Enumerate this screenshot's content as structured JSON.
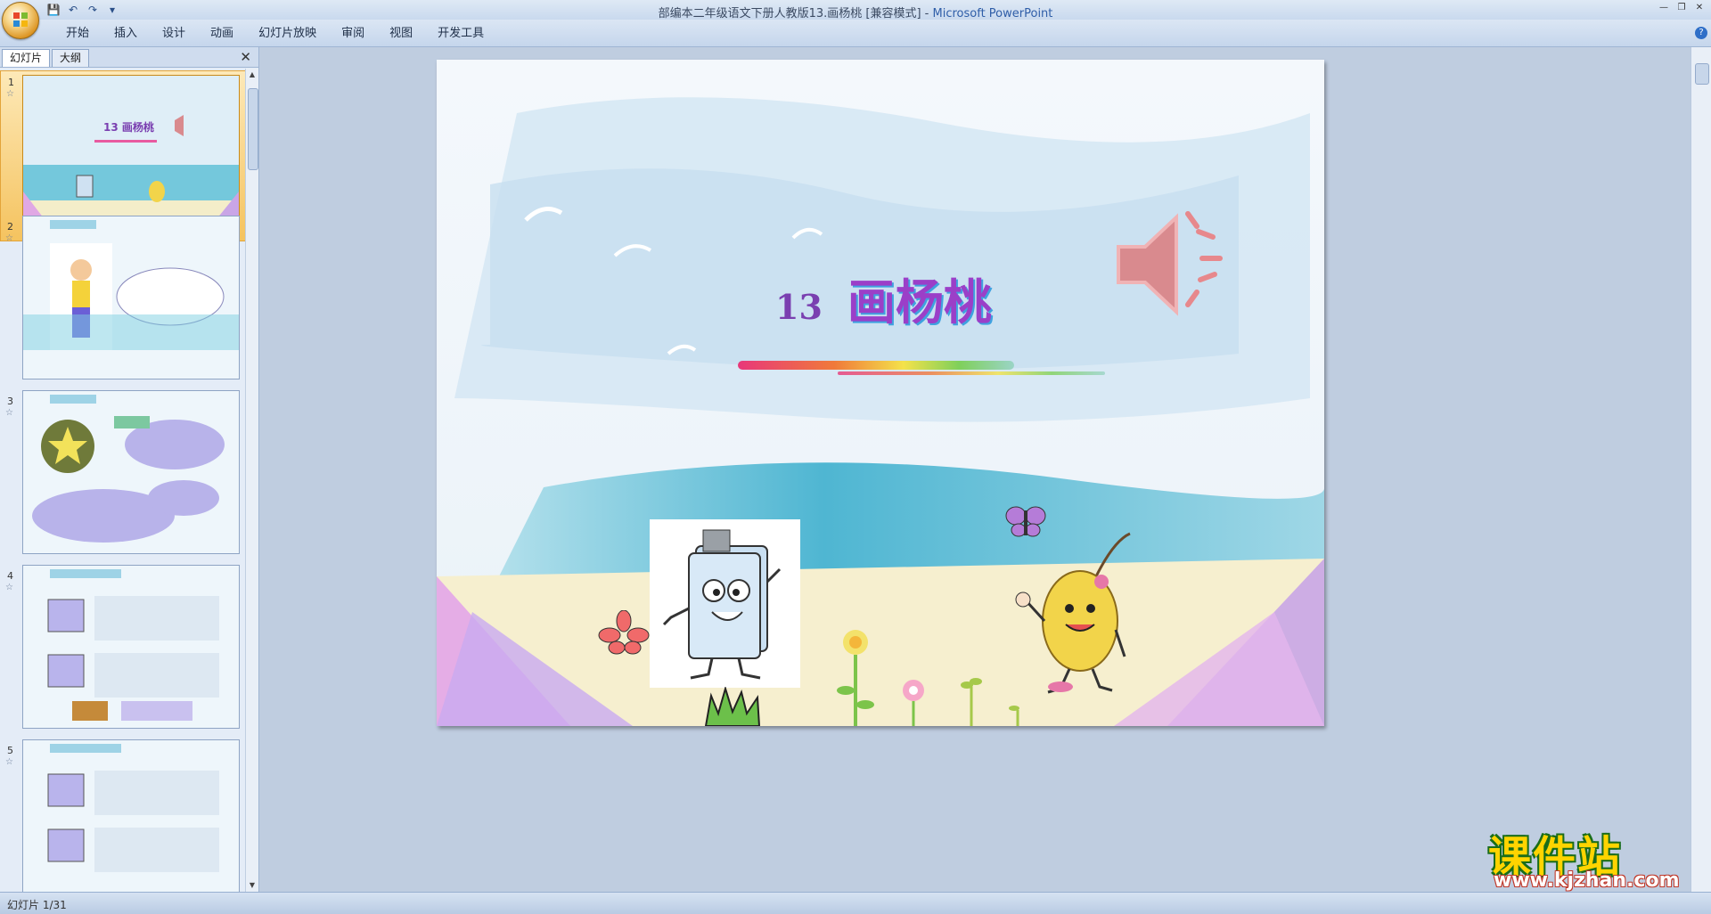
{
  "window": {
    "title": "部编本二年级语文下册人教版13.画杨桃 [兼容模式]",
    "app_name": "Microsoft PowerPoint",
    "separator": " - "
  },
  "ribbon": {
    "tabs": [
      "开始",
      "插入",
      "设计",
      "动画",
      "幻灯片放映",
      "审阅",
      "视图",
      "开发工具"
    ]
  },
  "panel": {
    "tab_slides": "幻灯片",
    "tab_outline": "大纲",
    "thumbnails": [
      {
        "number": "1"
      },
      {
        "number": "2"
      },
      {
        "number": "3"
      },
      {
        "number": "4"
      },
      {
        "number": "5"
      }
    ]
  },
  "slide": {
    "lesson_number": "13",
    "lesson_title": "画杨桃"
  },
  "status": {
    "slide_indicator": "幻灯片 1/31"
  },
  "watermark": {
    "name": "课件站",
    "url": "www.kjzhan.com"
  },
  "colors": {
    "selected_thumb": "#f5c35f",
    "title_purple": "#7a3fb0",
    "speaker": "#d98a8e"
  }
}
